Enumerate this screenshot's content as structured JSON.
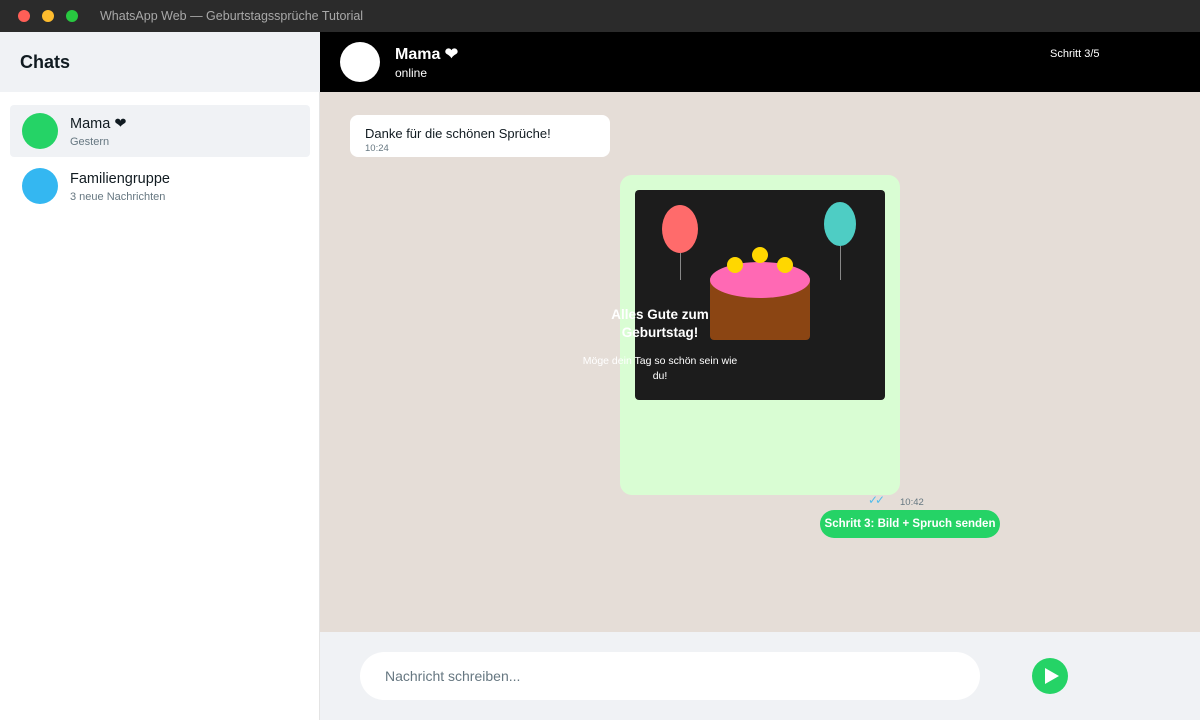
{
  "window": {
    "title": "WhatsApp Web — Geburtstagssprüche Tutorial"
  },
  "sidebar": {
    "title": "Chats",
    "chats": [
      {
        "name": "Mama ❤",
        "subtitle": "Gestern",
        "avatar_color": "#25d366"
      },
      {
        "name": "Familiengruppe",
        "subtitle": "3 neue Nachrichten",
        "avatar_color": "#34b7f1"
      }
    ]
  },
  "header": {
    "contact_name": "Mama ❤",
    "status": "online",
    "step": "Schritt 3/5"
  },
  "messages": {
    "incoming": {
      "text": "Danke für die schönen Sprüche!",
      "time": "10:24"
    },
    "outgoing": {
      "card_headline": "Alles Gute zum Geburtstag!",
      "card_wish": "Möge dein Tag so schön sein wie du!",
      "ticks": "✓✓",
      "time": "10:42"
    }
  },
  "tutorial": {
    "step_button_label": "Schritt 3: Bild + Spruch senden"
  },
  "composer": {
    "placeholder": "Nachricht schreiben...",
    "value": ""
  },
  "icons": {
    "send": "send-icon"
  },
  "colors": {
    "accent": "#25d366",
    "header_bg": "#000000",
    "chat_bg": "#e5ddd7",
    "outgoing_bubble": "#d9fdd3",
    "tick_blue": "#53bdeb"
  }
}
